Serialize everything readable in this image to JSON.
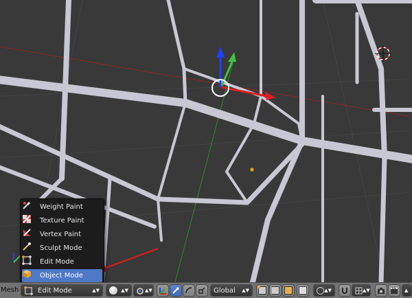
{
  "menu": {
    "items": [
      {
        "label": "Weight Paint",
        "active": false
      },
      {
        "label": "Texture Paint",
        "active": false
      },
      {
        "label": "Vertex Paint",
        "active": false
      },
      {
        "label": "Sculpt Mode",
        "active": false
      },
      {
        "label": "Edit Mode",
        "active": false
      },
      {
        "label": "Object Mode",
        "active": true
      }
    ]
  },
  "header": {
    "left_label": "Mesh",
    "mode_value": "Edit Mode",
    "orientation_value": "Global"
  },
  "colors": {
    "accent": "#4f78c6",
    "annotation_arrow": "#e21a1a",
    "mesh": "#c8c8d4",
    "axis_x": "#e02020",
    "axis_y": "#40c040",
    "axis_z": "#2040ff"
  }
}
